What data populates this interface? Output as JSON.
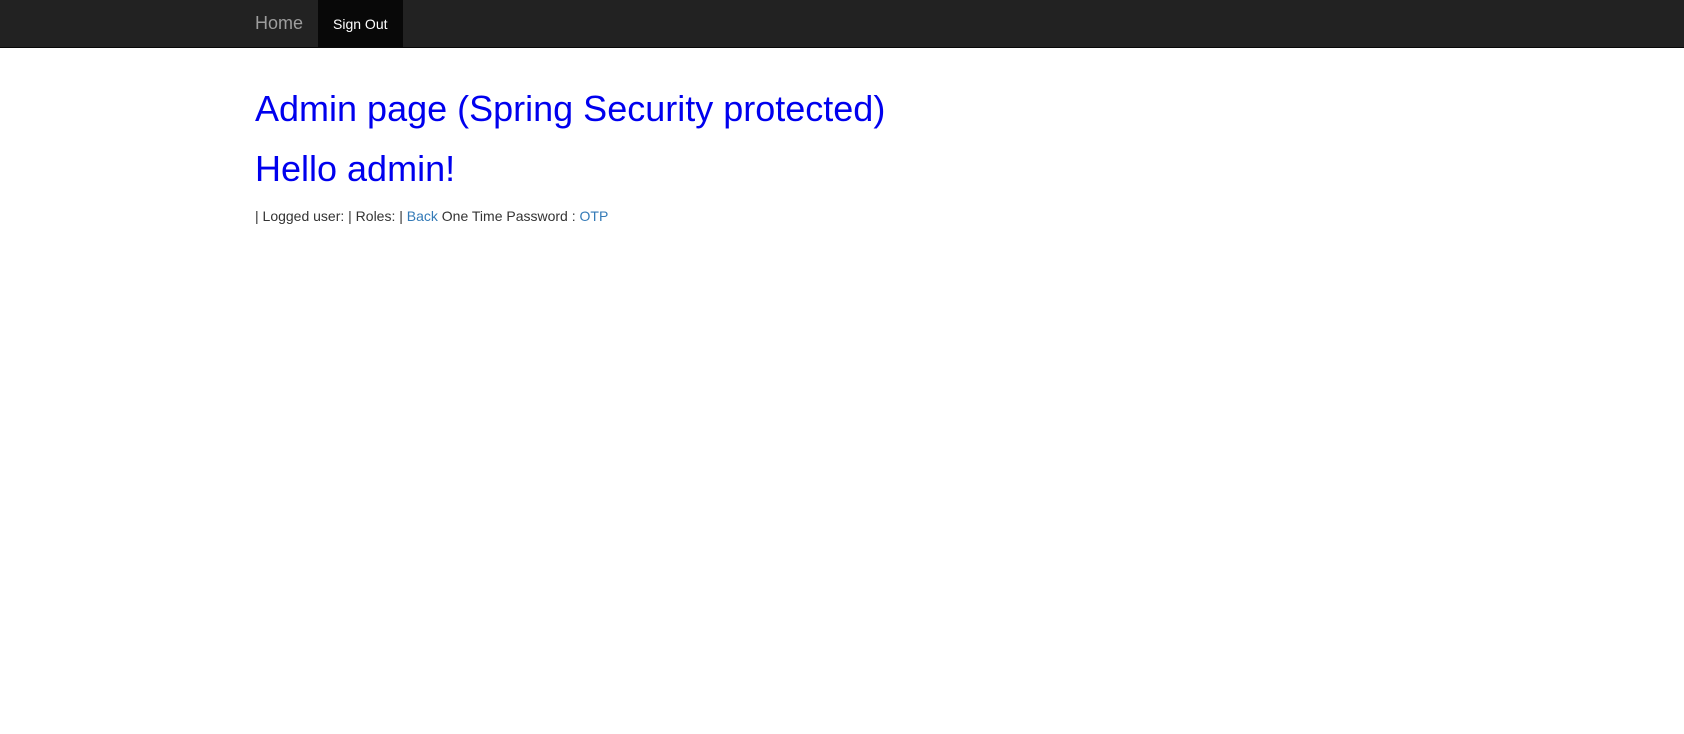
{
  "navbar": {
    "brand": "Home",
    "items": [
      {
        "label": "Sign Out"
      }
    ]
  },
  "main": {
    "title": "Admin page (Spring Security protected)",
    "greeting": "Hello admin!",
    "info": {
      "logged_user_text": "| Logged user: | Roles: |",
      "back_link": "Back",
      "otp_text": "One Time Password :",
      "otp_link": "OTP"
    }
  },
  "colors": {
    "navbar_bg": "#222222",
    "heading": "#0000ee",
    "link": "#337ab7"
  }
}
